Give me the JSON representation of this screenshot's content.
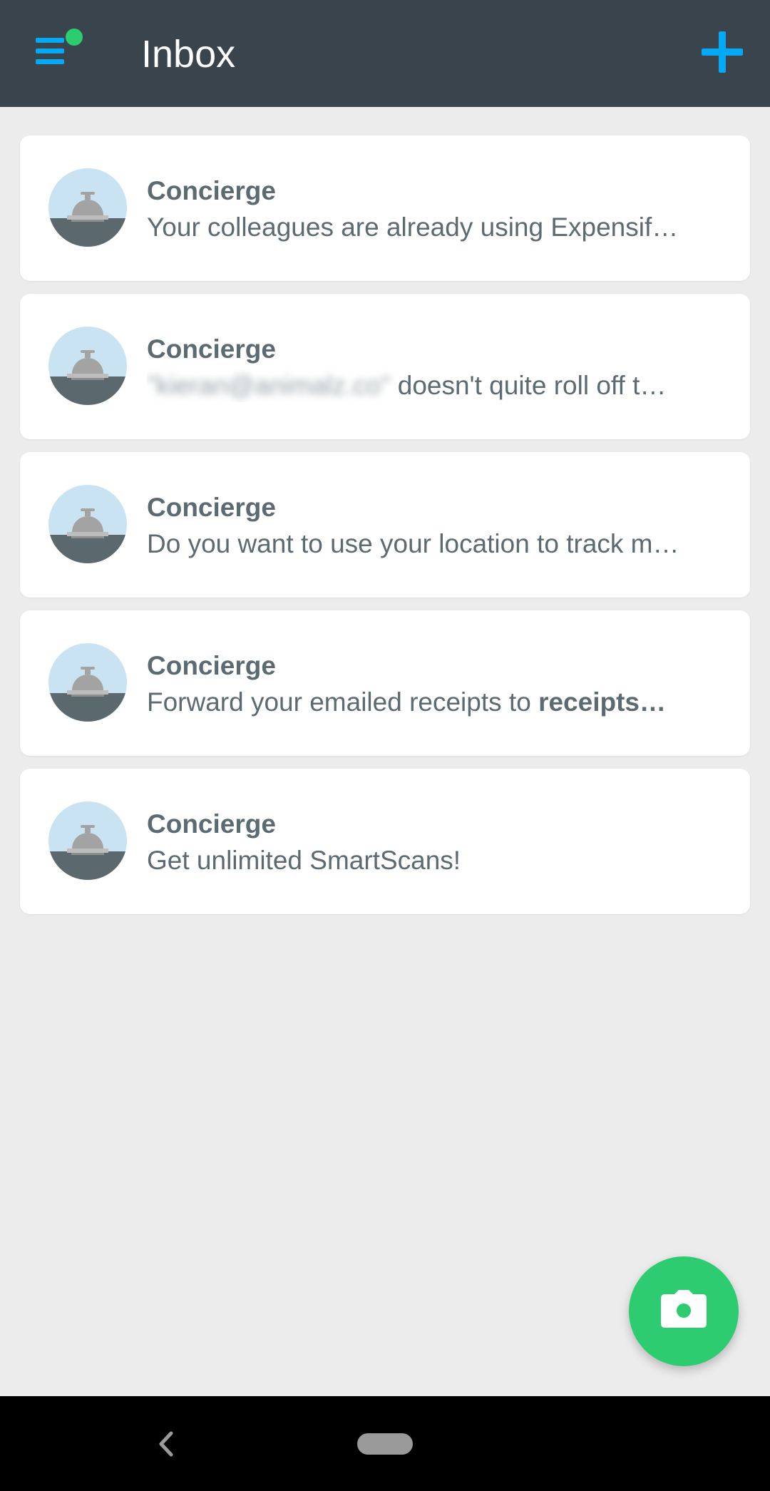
{
  "header": {
    "title": "Inbox",
    "menu_icon": "menu-icon",
    "add_icon": "plus-icon",
    "accent_color": "#03a9f4",
    "badge_color": "#2ecc71"
  },
  "conversations": [
    {
      "name": "Concierge",
      "preview_pre": "",
      "preview_blurred": "",
      "preview_text": "Your colleagues are already using Expensif…",
      "preview_bold": ""
    },
    {
      "name": "Concierge",
      "preview_pre": "",
      "preview_blurred": "\"kieran@animalz.co\"",
      "preview_text": " doesn't quite roll off t…",
      "preview_bold": ""
    },
    {
      "name": "Concierge",
      "preview_pre": "",
      "preview_blurred": "",
      "preview_text": "Do you want to use your location to track m…",
      "preview_bold": ""
    },
    {
      "name": "Concierge",
      "preview_pre": "",
      "preview_blurred": "",
      "preview_text": "Forward your emailed receipts to ",
      "preview_bold": "receipts…"
    },
    {
      "name": "Concierge",
      "preview_pre": "",
      "preview_blurred": "",
      "preview_text": "Get unlimited SmartScans!",
      "preview_bold": ""
    }
  ],
  "fab": {
    "icon": "camera-icon",
    "color": "#2ecc71"
  },
  "navigation": {
    "back_icon": "back-chevron-icon",
    "home_icon": "home-pill-icon"
  }
}
